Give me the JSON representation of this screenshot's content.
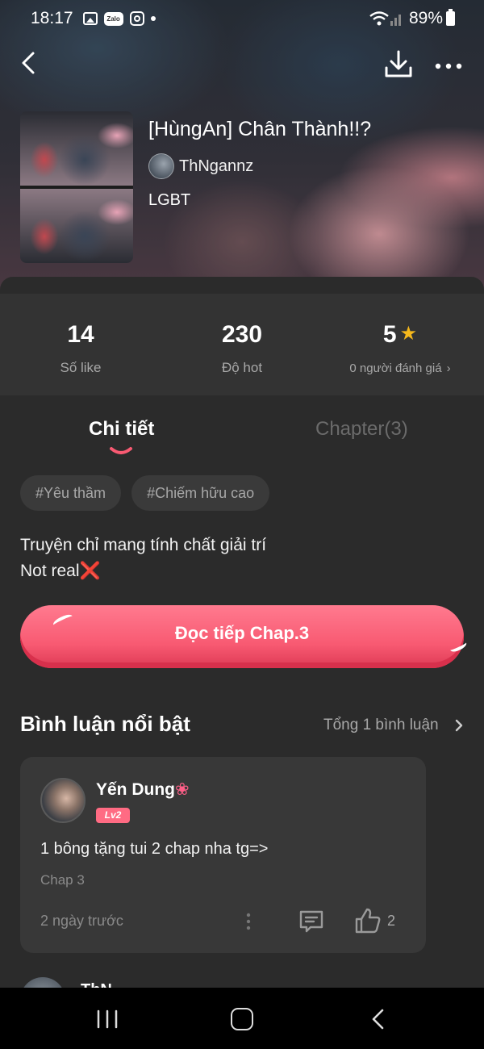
{
  "status_bar": {
    "time": "18:17",
    "zalo_label": "Zalo",
    "battery": "89%"
  },
  "story": {
    "title": "[HùngAn] Chân Thành!!?",
    "author": "ThNgannz",
    "genre": "LGBT"
  },
  "stats": {
    "likes_value": "14",
    "likes_label": "Số like",
    "hot_value": "230",
    "hot_label": "Độ hot",
    "rating_value": "5",
    "rating_label": "0 người đánh giá"
  },
  "tabs": {
    "details": "Chi tiết",
    "chapters": "Chapter(3)"
  },
  "tags": [
    "#Yêu thầm",
    "#Chiếm hữu cao"
  ],
  "description": {
    "line1": "Truyện chỉ mang tính chất giải trí",
    "line2": "Not real"
  },
  "read_button": "Đọc tiếp Chap.3",
  "comments": {
    "title": "Bình luận nổi bật",
    "total_link": "Tổng 1 bình luận",
    "items": [
      {
        "name": "Yến Dung",
        "level": "Lv2",
        "text": "1 bông tặng tui 2 chap nha tg=>",
        "chapter": "Chap 3",
        "time": "2 ngày trước",
        "likes": "2"
      }
    ],
    "next_name_partial": "ThN"
  },
  "colors": {
    "accent": "#f85a72",
    "background": "#2b2b2b",
    "star": "#f5b81c"
  }
}
